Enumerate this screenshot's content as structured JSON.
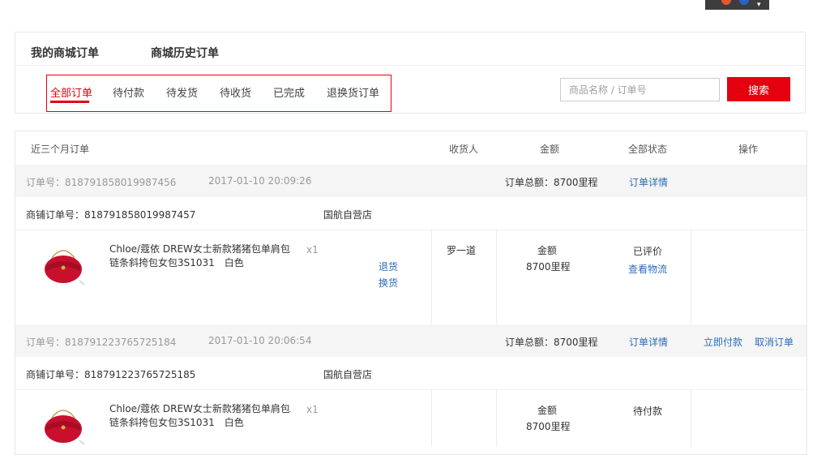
{
  "header": {
    "tabs": [
      "我的商城订单",
      "商城历史订单"
    ],
    "subtabs": [
      "全部订单",
      "待付款",
      "待发货",
      "待收货",
      "已完成",
      "退换货订单"
    ],
    "active_subtab": 0,
    "search": {
      "placeholder": "商品名称 / 订单号",
      "button": "搜索"
    }
  },
  "colors": {
    "accent": "#e4000f",
    "link": "#2b6cb6"
  },
  "table": {
    "columns": [
      "近三个月订单",
      "收货人",
      "金额",
      "全部状态",
      "操作"
    ],
    "orders": [
      {
        "order_label": "订单号：818791858019987456",
        "time": "2017-01-10 20:09:26",
        "total": "订单总额：8700里程",
        "detail_link": "订单详情",
        "shop_order": "商铺订单号：818791858019987457",
        "shop_name": "国航自营店",
        "product": "Chloe/蔻依 DREW女士新款猪猪包单肩包链条斜挎包女包3S1031　白色",
        "qty": "x1",
        "item_actions": [
          "退货",
          "换货"
        ],
        "receiver": "罗一道",
        "amount_label": "金额",
        "amount": "8700里程",
        "status": "已评价",
        "status_link": "查看物流"
      },
      {
        "order_label": "订单号：818791223765725184",
        "time": "2017-01-10 20:06:54",
        "total": "订单总额：8700里程",
        "detail_link": "订单详情",
        "actions": [
          "立即付款",
          "取消订单"
        ],
        "shop_order": "商铺订单号：818791223765725185",
        "shop_name": "国航自营店",
        "product": "Chloe/蔻依 DREW女士新款猪猪包单肩包链条斜挎包女包3S1031　白色",
        "qty": "x1",
        "amount_label": "金额",
        "amount": "8700里程",
        "status": "待付款"
      }
    ]
  }
}
